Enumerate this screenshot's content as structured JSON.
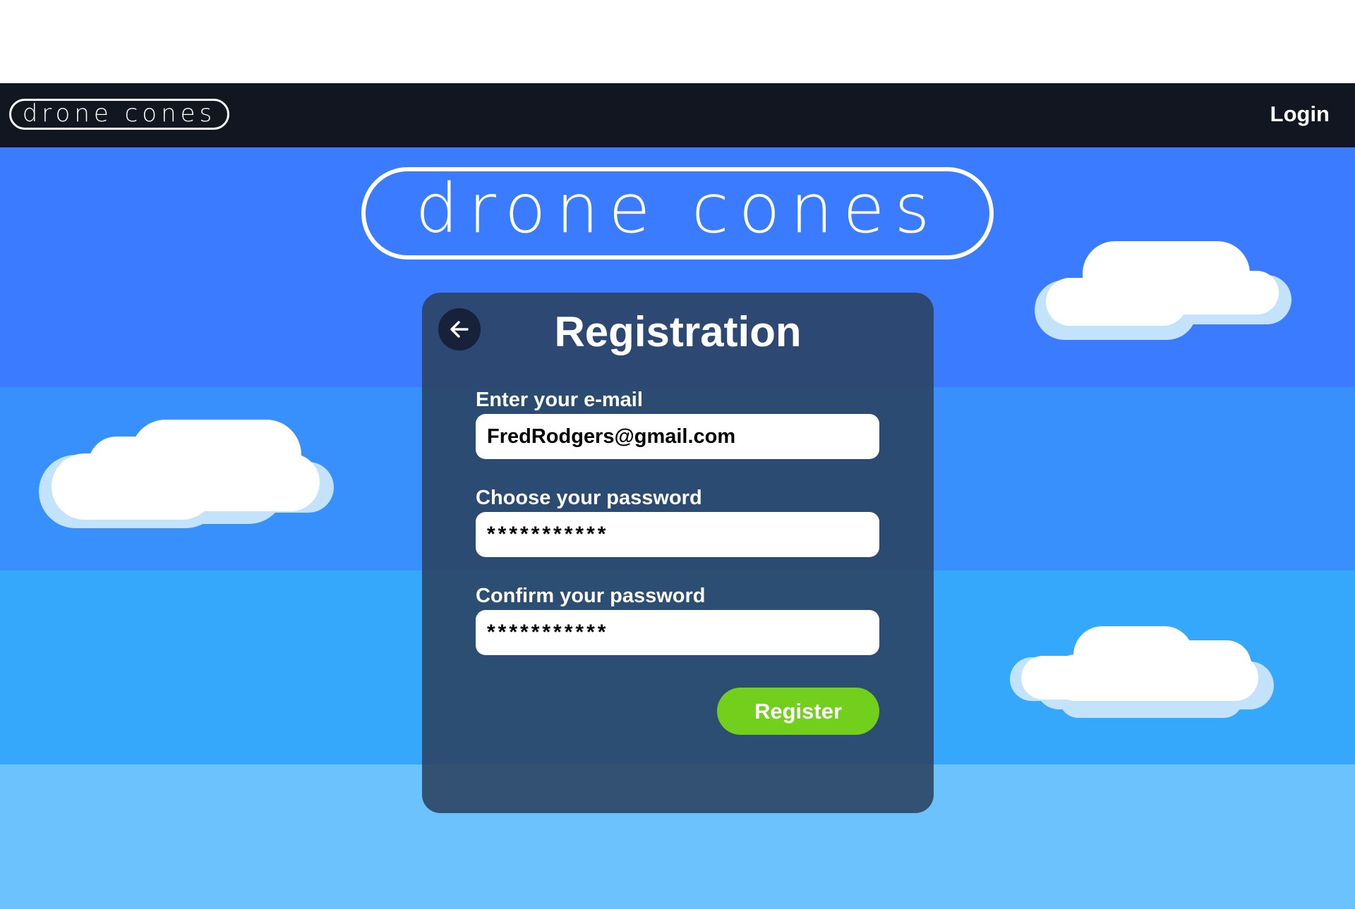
{
  "brand": {
    "name": "drone cones",
    "colors": {
      "navbar": "#111621",
      "sky_band_1": "#3a7bff",
      "sky_band_2": "#3890fd",
      "sky_band_3": "#36a8fc",
      "sky_band_4": "#6cc2fd",
      "panel": "#2b405e",
      "register_button": "#72cf1c"
    }
  },
  "navbar": {
    "logo_text": "drone cones",
    "login_label": "Login"
  },
  "hero": {
    "logo_text": "drone cones"
  },
  "registration": {
    "title": "Registration",
    "back_icon": "arrow-left-icon",
    "email": {
      "label": "Enter your e-mail",
      "value": "FredRodgers@gmail.com"
    },
    "password": {
      "label": "Choose your password",
      "value": "***********"
    },
    "confirm_password": {
      "label": "Confirm your password",
      "value": "***********"
    },
    "register_label": "Register"
  }
}
